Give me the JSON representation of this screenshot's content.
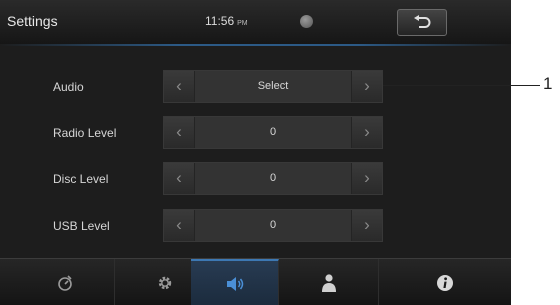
{
  "header": {
    "title": "Settings",
    "time": "11:56",
    "ampm": "PM"
  },
  "rows": [
    {
      "label": "Audio",
      "value": "Select"
    },
    {
      "label": "Radio Level",
      "value": "0"
    },
    {
      "label": "Disc Level",
      "value": "0"
    },
    {
      "label": "USB Level",
      "value": "0"
    }
  ],
  "arrows": {
    "left": "‹",
    "right": "›"
  },
  "bottom_bar": {
    "items": [
      {
        "icon": "timer-icon"
      },
      {
        "icon": "gear-icon"
      },
      {
        "icon": "speaker-icon",
        "active": true
      },
      {
        "icon": "person-icon"
      },
      {
        "icon": "info-icon"
      }
    ]
  },
  "callout": {
    "number": "1"
  },
  "colors": {
    "background": "#1d1d1d",
    "accent": "#3d78b3",
    "text": "#d6d6d6"
  }
}
